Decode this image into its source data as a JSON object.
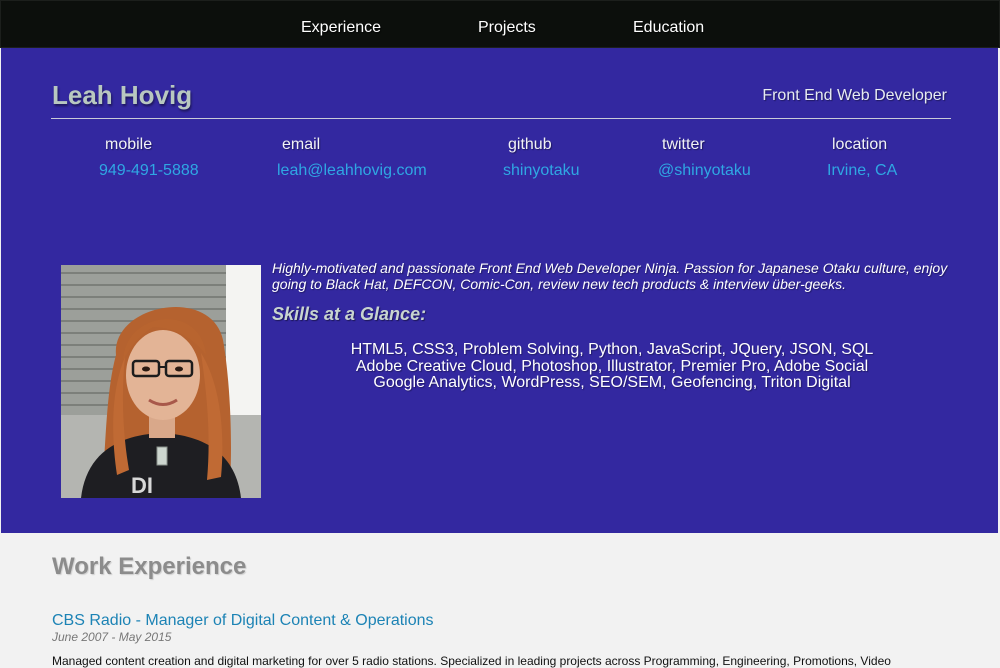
{
  "nav": {
    "items": [
      {
        "label": "Experience"
      },
      {
        "label": "Projects"
      },
      {
        "label": "Education"
      }
    ]
  },
  "header": {
    "name": "Leah Hovig",
    "role": "Front End Web Developer"
  },
  "contact": [
    {
      "label": "mobile",
      "value": "949-491-5888"
    },
    {
      "label": "email",
      "value": "leah@leahhovig.com"
    },
    {
      "label": "github",
      "value": "shinyotaku"
    },
    {
      "label": "twitter",
      "value": "@shinyotaku"
    },
    {
      "label": "location",
      "value": "Irvine, CA"
    }
  ],
  "about": {
    "summary": "Highly-motivated and passionate Front End Web Developer Ninja. Passion for Japanese Otaku culture, enjoy going to Black Hat, DEFCON, Comic-Con, review new tech products & interview über-geeks.",
    "skills_heading": "Skills at a Glance:",
    "skills_lines": [
      "HTML5, CSS3, Problem Solving, Python, JavaScript, JQuery, JSON, SQL",
      "Adobe Creative Cloud, Photoshop, Illustrator, Premier Pro, Adobe Social",
      "Google Analytics, WordPress, SEO/SEM, Geofencing, Triton Digital"
    ]
  },
  "work": {
    "heading": "Work Experience",
    "jobs": [
      {
        "title": "CBS Radio - Manager of Digital Content & Operations",
        "dates": "June 2007 - May 2015",
        "description": "Managed content creation and digital marketing for over 5 radio stations. Specialized in leading projects across Programming, Engineering, Promotions, Video"
      }
    ]
  },
  "colors": {
    "nav_background": "#0c0f0c",
    "hero_background": "#3328a0",
    "link": "#2fa7e3",
    "job_title": "#1c83b5",
    "section_background": "#f2f2f2"
  }
}
